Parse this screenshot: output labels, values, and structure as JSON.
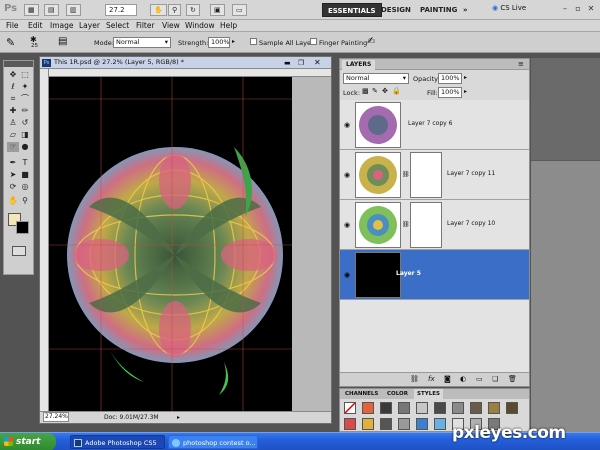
{
  "app": {
    "logo": "Ps",
    "zoom": "27.2",
    "workspaces": [
      "ESSENTIALS",
      "DESIGN",
      "PAINTING"
    ],
    "more": "»",
    "cs_live": "CS Live"
  },
  "menu": [
    "File",
    "Edit",
    "Image",
    "Layer",
    "Select",
    "Filter",
    "View",
    "Window",
    "Help"
  ],
  "options": {
    "brush_size": "25",
    "mode_label": "Mode:",
    "mode_value": "Normal",
    "strength_label": "Strength:",
    "strength_value": "100%",
    "sample_all_layers": "Sample All Layers",
    "finger_painting": "Finger Painting"
  },
  "document": {
    "title": "This 1R.psd @ 27.2% (Layer 5, RGB/8) *",
    "zoom_status": "27.24%",
    "doc_status": "Doc: 9.01M/27.3M"
  },
  "layers_panel": {
    "tab": "LAYERS",
    "blend_mode": "Normal",
    "opacity_label": "Opacity:",
    "opacity_value": "100%",
    "lock_label": "Lock:",
    "fill_label": "Fill:",
    "fill_value": "100%",
    "layers": [
      {
        "name": "Layer 7 copy 6",
        "selected": false
      },
      {
        "name": "Layer 7 copy 11",
        "selected": false
      },
      {
        "name": "Layer 7 copy 10",
        "selected": false
      },
      {
        "name": "Layer 5",
        "selected": true
      }
    ],
    "footer_icons": [
      "link-icon",
      "fx-icon",
      "mask-icon",
      "adjustment-icon",
      "folder-icon",
      "new-layer-icon",
      "trash-icon"
    ]
  },
  "styles_panel": {
    "tabs": [
      "CHANNELS",
      "COLOR",
      "STYLES"
    ],
    "active_tab": "STYLES"
  },
  "taskbar": {
    "start": "start",
    "tasks": [
      "Adobe Photoshop CS5",
      "photoshop contest o..."
    ]
  },
  "watermark": "pxleyes.com",
  "colors": {
    "selected_layer": "#3b6ec7",
    "taskbar": "#245edb",
    "start_button": "#2e8a2e"
  }
}
